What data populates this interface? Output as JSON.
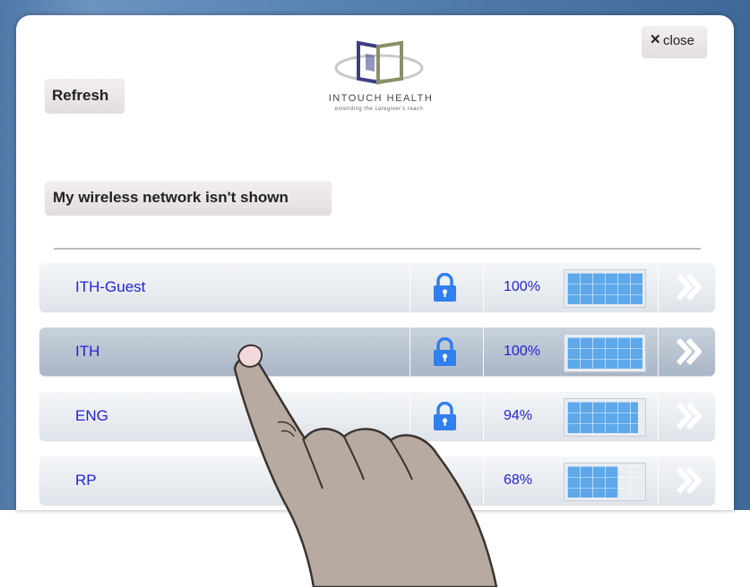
{
  "header": {
    "close": {
      "icon": "close-x-icon",
      "glyph": "✕",
      "label": "close"
    },
    "refresh_label": "Refresh",
    "logo": {
      "name": "INTOUCH HEALTH",
      "tagline": "extending the caregiver's reach"
    }
  },
  "not_shown_label": "My wireless network isn't shown",
  "networks": [
    {
      "name": "ITH-Guest",
      "secured": true,
      "signal": "100%",
      "signal_level": 1.0,
      "selected": false
    },
    {
      "name": "ITH",
      "secured": true,
      "signal": "100%",
      "signal_level": 1.0,
      "selected": true
    },
    {
      "name": "ENG",
      "secured": true,
      "signal": "94%",
      "signal_level": 0.94,
      "selected": false
    },
    {
      "name": "RP",
      "secured": false,
      "signal": "68%",
      "signal_level": 0.68,
      "selected": false
    }
  ],
  "icons": {
    "lock": "lock-icon",
    "chevron": "double-chevron-right-icon",
    "hand": "pointing-hand-icon"
  },
  "colors": {
    "network_text": "#2323d6",
    "signal_fill": "#5da8ea",
    "lock_blue": "#2f7ff0",
    "background_blue": "#4f78a8"
  }
}
